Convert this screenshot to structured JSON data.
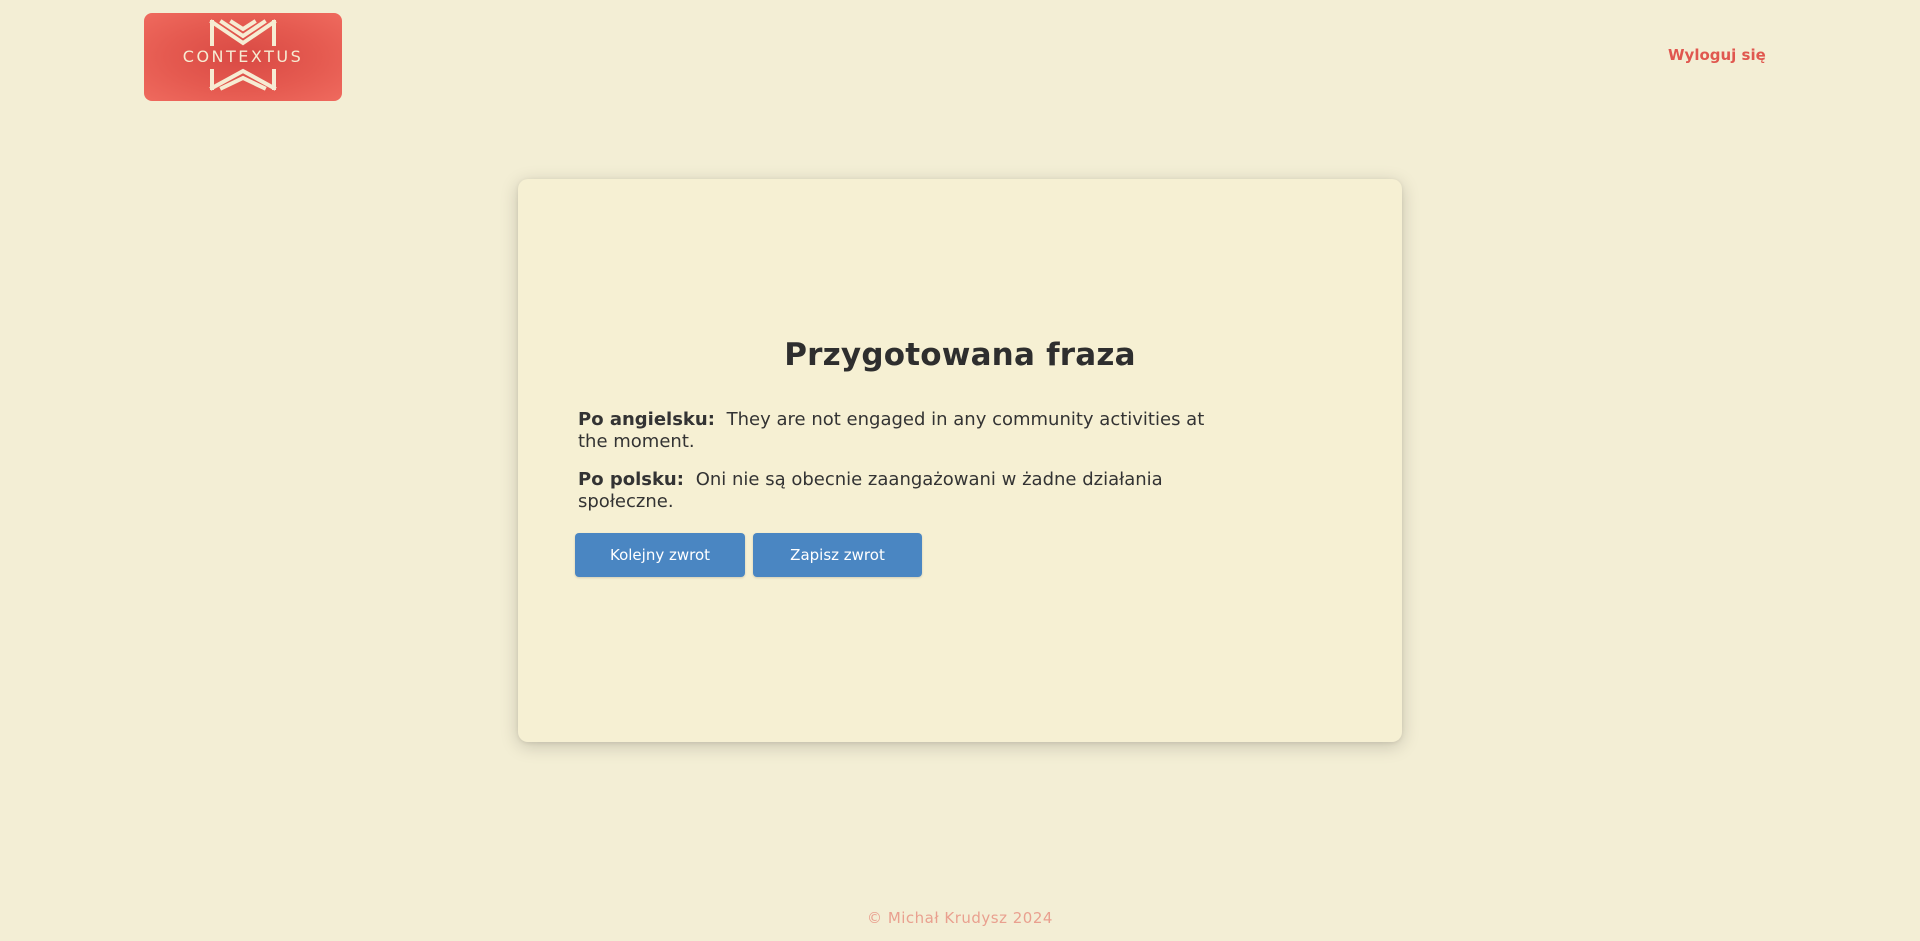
{
  "header": {
    "logo_text": "CONTEXTUS",
    "logout_label": "Wyloguj się"
  },
  "card": {
    "title": "Przygotowana fraza",
    "english_label": "Po angielsku:",
    "english_text": "They are not engaged in any community activities at the moment.",
    "polish_label": "Po polsku:",
    "polish_text": "Oni nie są obecnie zaangażowani w żadne działania społeczne.",
    "next_button": "Kolejny zwrot",
    "save_button": "Zapisz zwrot"
  },
  "footer": {
    "copyright": "© Michał Krudysz 2024"
  },
  "colors": {
    "background": "#f3eed5",
    "card": "#f6f0d3",
    "accent": "#e0574f",
    "button": "#4a86c2",
    "footer_text": "#e9a08f"
  },
  "icons": {
    "logo": "contextus-logo-icon"
  }
}
